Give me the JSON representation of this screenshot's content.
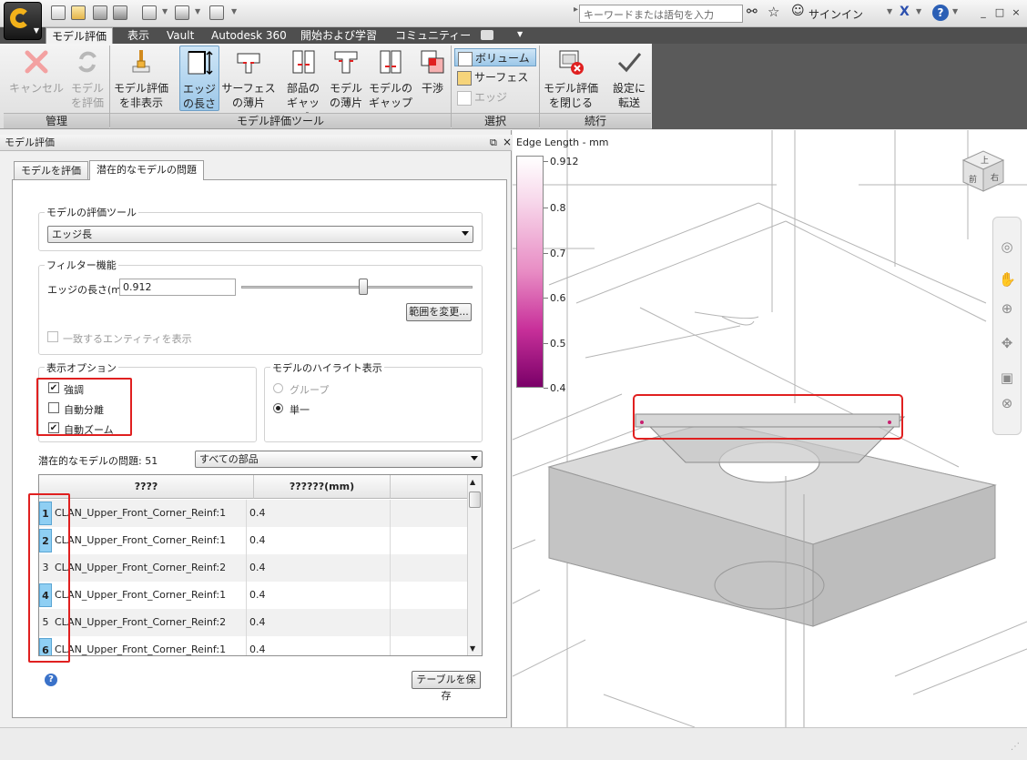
{
  "title_bar": {
    "search_placeholder": "キーワードまたは語句を入力",
    "signin": "サインイン",
    "help": "?",
    "minimize": "_",
    "restore": "□",
    "close": "×"
  },
  "ribbon_tabs": [
    "モデル評価",
    "表示",
    "Vault",
    "Autodesk 360",
    "開始および学習",
    "コミュニティー"
  ],
  "ribbon": {
    "cancel": [
      "キャンセル",
      ""
    ],
    "evaluate": [
      "モデル",
      "を評価"
    ],
    "hide_eval": [
      "モデル評価",
      "を非表示"
    ],
    "edge_length": [
      "エッジ",
      "の長さ"
    ],
    "surface_thin": [
      "サーフェス",
      "の薄片"
    ],
    "part_gap": [
      "部品の",
      "ギャップ"
    ],
    "model_thin": [
      "モデル",
      "の薄片"
    ],
    "model_gap": [
      "モデルの",
      "ギャップ"
    ],
    "interference": [
      "干渉",
      ""
    ],
    "volume": "ボリューム",
    "surface": "サーフェス",
    "edge": "エッジ",
    "close_eval": [
      "モデル評価",
      "を閉じる"
    ],
    "transfer": [
      "設定に",
      "転送"
    ],
    "panels": {
      "manage": "管理",
      "tools": "モデル評価ツール",
      "select": "選択",
      "continue": "続行"
    }
  },
  "left_panel": {
    "header": "モデル評価",
    "tabs": [
      "モデルを評価",
      "潜在的なモデルの問題"
    ],
    "eval_tool_group": "モデルの評価ツール",
    "eval_tool_value": "エッジ長",
    "filter_group": "フィルター機能",
    "edge_length_label": "エッジの長さ(mm)",
    "edge_length_value": "0.912",
    "slider_value": 0.55,
    "change_range_button": "範囲を変更...",
    "show_matching": "一致するエンティティを表示",
    "display_options_group": "表示オプション",
    "options": [
      {
        "label": "強調",
        "checked": true
      },
      {
        "label": "自動分離",
        "checked": false
      },
      {
        "label": "自動ズーム",
        "checked": true
      }
    ],
    "highlight_group": "モデルのハイライト表示",
    "highlight_group_option": "グループ",
    "highlight_single_option": "単一",
    "issues_label": "潜在的なモデルの問題: 51",
    "parts_filter": "すべての部品",
    "table": {
      "headers": [
        "????",
        "??????(mm)"
      ],
      "rows": [
        {
          "n": "1",
          "name": "CLAN_Upper_Front_Corner_Reinf:1",
          "value": "0.4",
          "hl": true
        },
        {
          "n": "2",
          "name": "CLAN_Upper_Front_Corner_Reinf:1",
          "value": "0.4",
          "hl": true
        },
        {
          "n": "3",
          "name": "CLAN_Upper_Front_Corner_Reinf:2",
          "value": "0.4",
          "hl": false
        },
        {
          "n": "4",
          "name": "CLAN_Upper_Front_Corner_Reinf:1",
          "value": "0.4",
          "hl": true
        },
        {
          "n": "5",
          "name": "CLAN_Upper_Front_Corner_Reinf:2",
          "value": "0.4",
          "hl": false
        },
        {
          "n": "6",
          "name": "CLAN_Upper_Front_Corner_Reinf:1",
          "value": "0.4",
          "hl": true
        }
      ]
    },
    "save_table_button": "テーブルを保存"
  },
  "viewport": {
    "legend_title": "Edge Length - mm",
    "legend_ticks": [
      "0.912",
      "0.8",
      "0.7",
      "0.6",
      "0.5",
      "0.4"
    ],
    "viewcube_top": "上",
    "viewcube_front": "前",
    "viewcube_right": "右"
  }
}
